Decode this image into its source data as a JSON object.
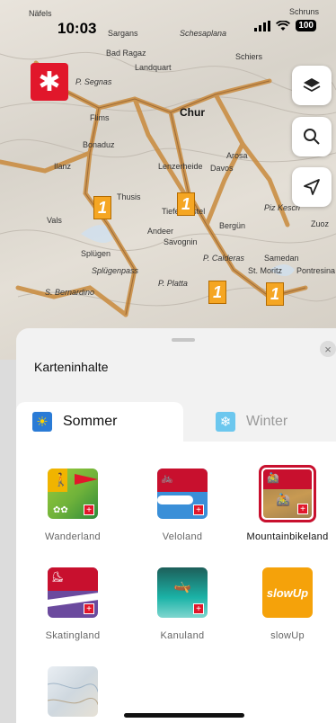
{
  "status_bar": {
    "time": "10:03",
    "battery": "100"
  },
  "map": {
    "labels": [
      {
        "text": "Näfels"
      },
      {
        "text": "Sargans"
      },
      {
        "text": "Schesaplana"
      },
      {
        "text": "Schruns"
      },
      {
        "text": "Bad Ragaz"
      },
      {
        "text": "Schiers"
      },
      {
        "text": "Landquart"
      },
      {
        "text": "P. Segnas"
      },
      {
        "text": "Flims"
      },
      {
        "text": "Chur"
      },
      {
        "text": "Bonaduz"
      },
      {
        "text": "Ilanz"
      },
      {
        "text": "Arosa"
      },
      {
        "text": "Davos"
      },
      {
        "text": "Lenzerheide"
      },
      {
        "text": "Thusis"
      },
      {
        "text": "Tiefencastel"
      },
      {
        "text": "Vals"
      },
      {
        "text": "Piz Kesch"
      },
      {
        "text": "Splügen"
      },
      {
        "text": "Andeer"
      },
      {
        "text": "Savognin"
      },
      {
        "text": "Bergün"
      },
      {
        "text": "Zuoz"
      },
      {
        "text": "Splügenpass"
      },
      {
        "text": "Samedan"
      },
      {
        "text": "St. Moritz"
      },
      {
        "text": "P. Calderas"
      },
      {
        "text": "P. Platta"
      },
      {
        "text": "S. Bernardino"
      },
      {
        "text": "Pontresina"
      }
    ]
  },
  "sheet": {
    "title": "Karteninhalte",
    "close_label": "×",
    "tabs": [
      {
        "label": "Sommer",
        "active": true
      },
      {
        "label": "Winter",
        "active": false
      }
    ],
    "tiles": [
      {
        "label": "Wanderland",
        "icon": "hiking-icon",
        "selected": false
      },
      {
        "label": "Veloland",
        "icon": "cycling-icon",
        "selected": false
      },
      {
        "label": "Mountainbikeland",
        "icon": "mountainbike-icon",
        "selected": true
      },
      {
        "label": "Skatingland",
        "icon": "skating-icon",
        "selected": false
      },
      {
        "label": "Kanuland",
        "icon": "canoe-icon",
        "selected": false
      },
      {
        "label": "slowUp",
        "icon": "slowup-icon",
        "selected": false
      }
    ],
    "slowup_text": "slowUp"
  },
  "colors": {
    "accent_red": "#e1172b",
    "route_orange": "#c98a3c"
  }
}
